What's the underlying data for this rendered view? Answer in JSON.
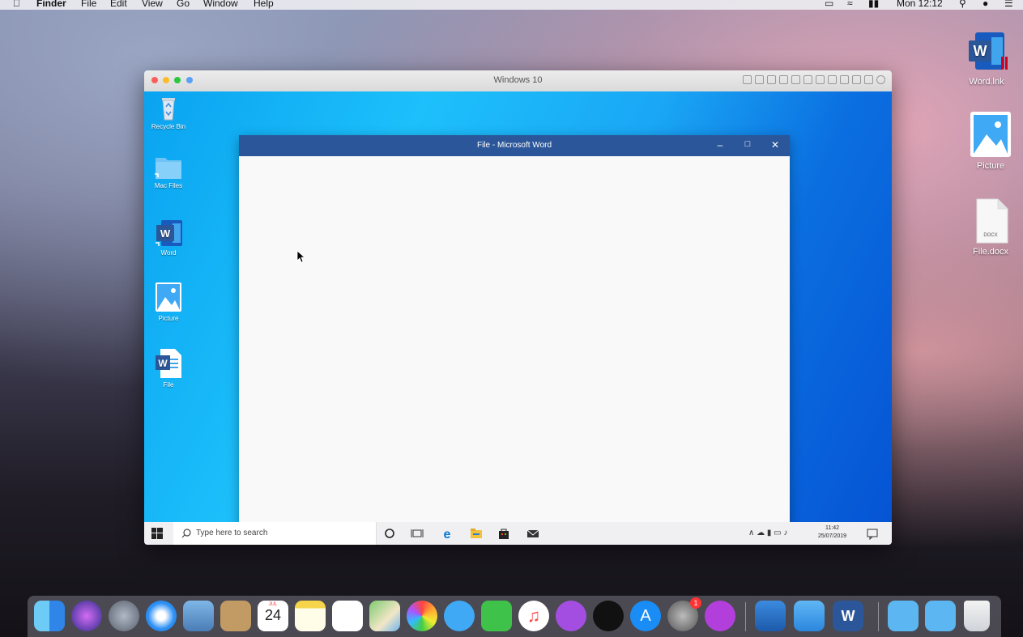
{
  "menubar": {
    "apple": "",
    "app_name": "Finder",
    "menus": [
      "File",
      "Edit",
      "View",
      "Go",
      "Window",
      "Help"
    ],
    "clock": "Mon 12:12"
  },
  "mac_desktop": {
    "icons": [
      {
        "label": "Word.lnk",
        "icon": "word-shortcut-icon"
      },
      {
        "label": "Picture",
        "icon": "picture-icon"
      },
      {
        "label": "File.docx",
        "icon": "docx-file-icon",
        "doc_tag": "DOCX"
      }
    ]
  },
  "vm": {
    "title": "Windows 10",
    "desktop_icons": [
      {
        "label": "Recycle Bin",
        "icon": "recycle-bin-icon"
      },
      {
        "label": "Mac Files",
        "icon": "folder-icon"
      },
      {
        "label": "Word",
        "icon": "word-icon"
      },
      {
        "label": "Picture",
        "icon": "picture-icon"
      },
      {
        "label": "File",
        "icon": "word-doc-icon"
      }
    ],
    "word_window": {
      "title": "File - Microsoft Word",
      "minimize": "–",
      "maximize": "□",
      "close": "✕"
    },
    "taskbar": {
      "search_placeholder": "Type here to search",
      "time": "11:42",
      "date": "25/07/2019"
    }
  },
  "dock": {
    "apps": [
      "Finder",
      "Siri",
      "Launchpad",
      "Safari",
      "Mail",
      "Contacts",
      "Calendar",
      "Notes",
      "Reminders",
      "Maps",
      "Photos",
      "Messages",
      "FaceTime",
      "Music",
      "Podcasts",
      "TV",
      "App Store",
      "System Preferences",
      "Feedback Assistant",
      "Parallels",
      "Windows",
      "Word",
      "Downloads",
      "Documents",
      "Trash"
    ],
    "calendar_day": "24",
    "calendar_month": "JUL",
    "sysprefs_badge": "1"
  },
  "colors": {
    "word_blue": "#2b579a",
    "win_accent": "#0078d7"
  }
}
